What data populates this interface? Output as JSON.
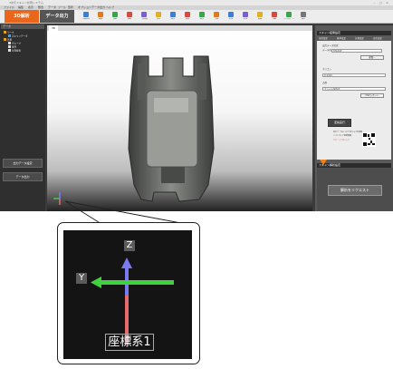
{
  "app": {
    "title": "3次元スキャン計測システム",
    "menu": [
      "ファイル",
      "編集",
      "表示",
      "整合",
      "データ",
      "ツール",
      "形状",
      "オプション",
      "データ出力",
      "ヘルプ"
    ],
    "tabs": [
      "3D解析",
      "データ出力"
    ],
    "tools": [
      "作業表示",
      "変換",
      "移動",
      "回転",
      "一括回転",
      "表示",
      "視点",
      "頂点",
      "統合",
      "平面",
      "計測",
      "計測",
      "断面",
      "CAD",
      "エクスポート",
      "設定"
    ]
  },
  "left_panel": {
    "header": "データ",
    "tree": [
      {
        "label": "ワーク",
        "level": 0
      },
      {
        "label": "スキャンデータ",
        "level": 1
      },
      {
        "label": "計測",
        "level": 0
      },
      {
        "label": "グループ",
        "level": 1
      },
      {
        "label": "基準",
        "level": 1
      },
      {
        "label": "計測要素",
        "level": 1
      }
    ],
    "buttons": [
      "出力データ設定",
      "データ出力"
    ]
  },
  "viewport": {
    "tab": "3D"
  },
  "right_panel": {
    "header": "スキャン結果設定",
    "tabs": [
      "形状設定",
      "基準設定",
      "計測設定",
      "出力設定"
    ],
    "labels": [
      "出力データ形式",
      "データ形式",
      "ポリゴン",
      "点群"
    ],
    "fields": [
      "STL形式",
      "0.1mm",
      "ファイル保存先"
    ],
    "buttons": [
      "参照...",
      "CSVレポート",
      "変換実行"
    ],
    "notes": [
      "出力データについてのヘルプを参照",
      "ソフトウェア更新情報"
    ],
    "link": "サポートへのリンク",
    "lower_header": "スキャン解析設定",
    "big_button": "解析をリクエスト"
  },
  "zoom_callout": {
    "axis_z": "Z",
    "axis_y": "Y",
    "label": "座標系1"
  },
  "colors": {
    "tab_active": "#e8671c",
    "axis_z": "#6a6ae8",
    "axis_y": "#3fd13f",
    "axis_x": "#e86a6a"
  }
}
